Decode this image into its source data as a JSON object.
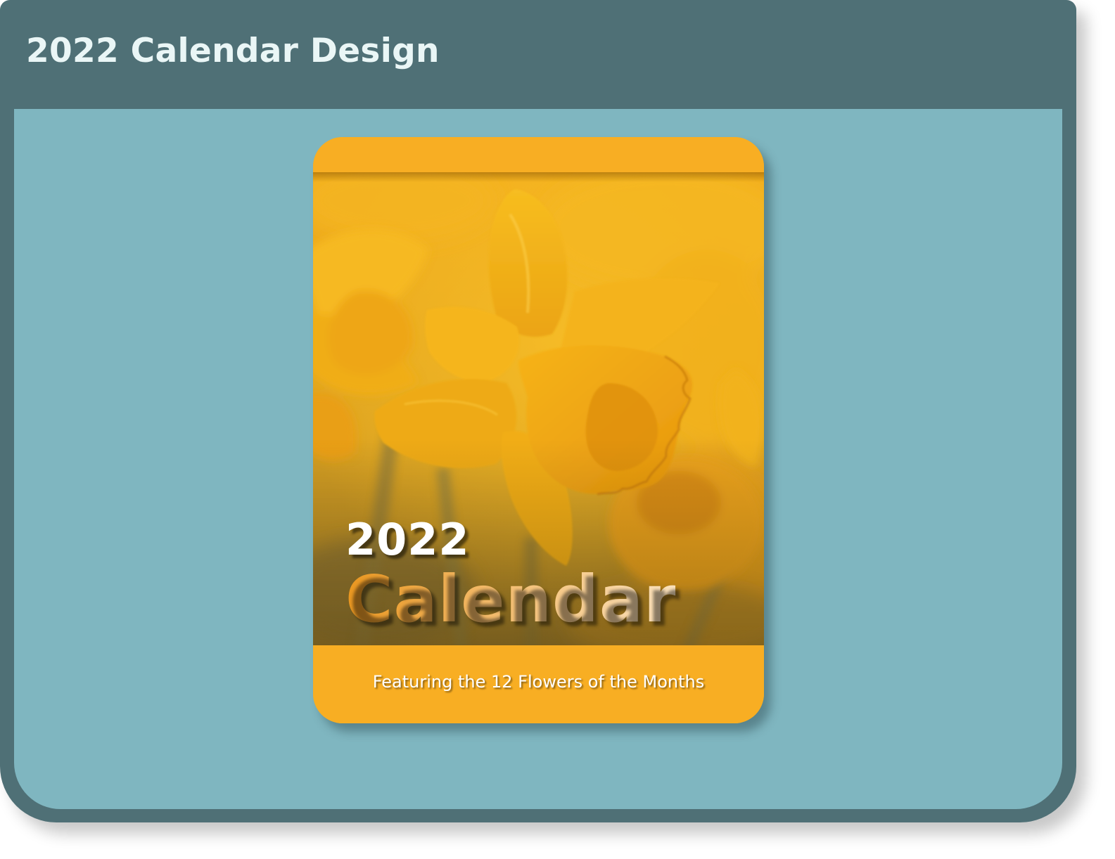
{
  "header": {
    "title": "2022 Calendar Design"
  },
  "calendar_cover": {
    "year": "2022",
    "title_word": "Calendar",
    "subtitle": "Featuring the 12 Flowers of the Months",
    "image": "daffodil-flowers-photo"
  },
  "colors": {
    "frame": "#4f7076",
    "panel": "#7fb6c0",
    "title_text": "#eaf6f6",
    "card_accent": "#f8ae23",
    "flower_yellow": "#f4b01d"
  }
}
